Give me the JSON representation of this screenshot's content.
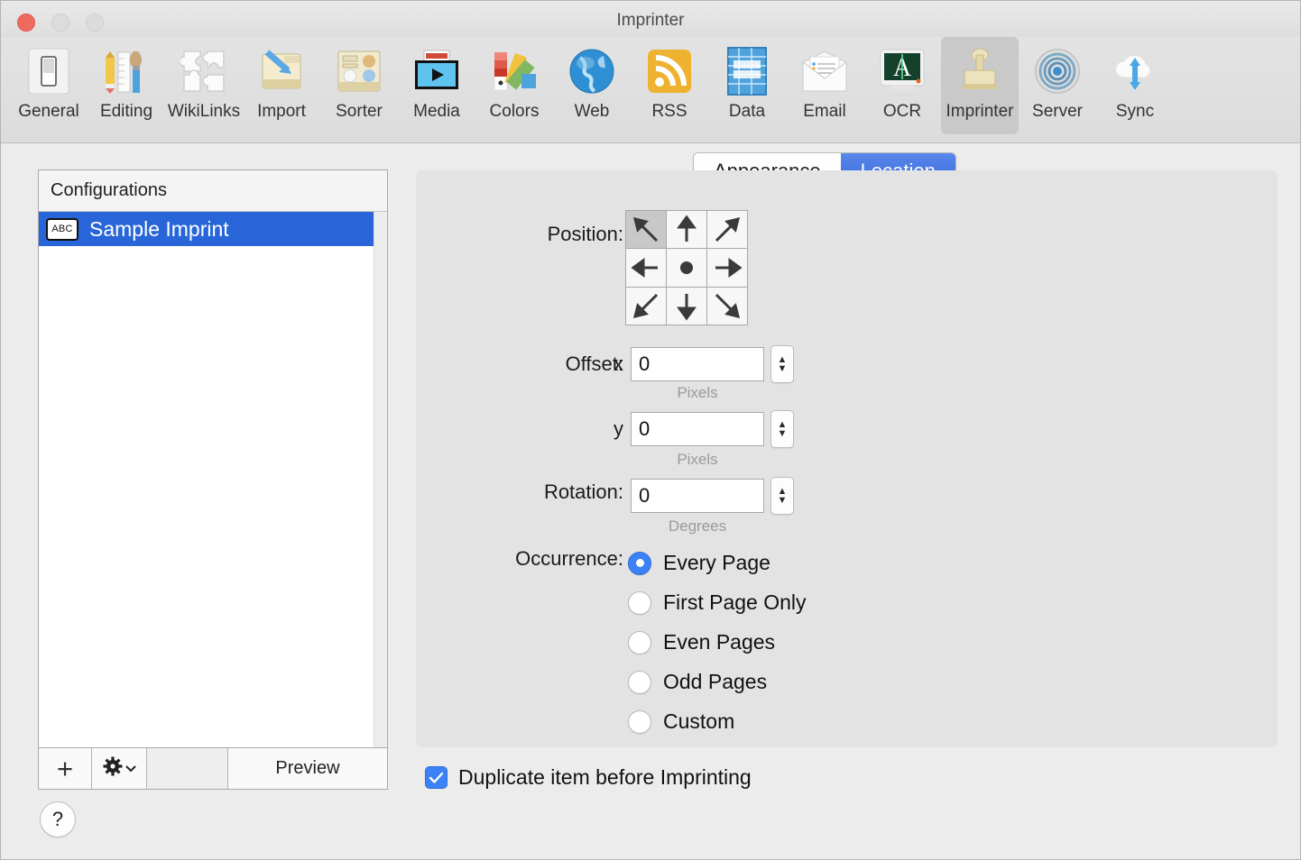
{
  "window": {
    "title": "Imprinter",
    "traffic_lights": [
      "close",
      "minimize",
      "zoom"
    ]
  },
  "toolbar": {
    "items": [
      {
        "label": "General",
        "icon": "switch-icon"
      },
      {
        "label": "Editing",
        "icon": "pencil-ruler-brush-icon"
      },
      {
        "label": "WikiLinks",
        "icon": "puzzle-icon"
      },
      {
        "label": "Import",
        "icon": "import-arrow-icon"
      },
      {
        "label": "Sorter",
        "icon": "sorter-tray-icon"
      },
      {
        "label": "Media",
        "icon": "media-play-icon"
      },
      {
        "label": "Colors",
        "icon": "color-swatches-icon"
      },
      {
        "label": "Web",
        "icon": "globe-icon"
      },
      {
        "label": "RSS",
        "icon": "rss-icon"
      },
      {
        "label": "Data",
        "icon": "data-table-icon"
      },
      {
        "label": "Email",
        "icon": "envelope-icon"
      },
      {
        "label": "OCR",
        "icon": "ocr-screen-icon"
      },
      {
        "label": "Imprinter",
        "icon": "stamp-icon",
        "selected": true
      },
      {
        "label": "Server",
        "icon": "server-rings-icon"
      },
      {
        "label": "Sync",
        "icon": "cloud-sync-icon"
      }
    ]
  },
  "sidebar": {
    "header": "Configurations",
    "rows": [
      {
        "badge": "ABC",
        "label": "Sample Imprint",
        "selected": true
      }
    ],
    "footer": {
      "add_label": "+",
      "gear_icon": "gear-icon",
      "chevron_icon": "chevron-down-icon",
      "preview_label": "Preview"
    }
  },
  "help": {
    "label": "?"
  },
  "tabs": {
    "items": [
      {
        "label": "Appearance",
        "active": false
      },
      {
        "label": "Location",
        "active": true
      }
    ]
  },
  "form": {
    "position": {
      "label": "Position:",
      "cells": [
        {
          "name": "top-left",
          "arrow": "↖",
          "selected": true
        },
        {
          "name": "top-center",
          "arrow": "↑",
          "selected": false
        },
        {
          "name": "top-right",
          "arrow": "↗",
          "selected": false
        },
        {
          "name": "middle-left",
          "arrow": "←",
          "selected": false
        },
        {
          "name": "center",
          "arrow": "●",
          "selected": false
        },
        {
          "name": "middle-right",
          "arrow": "→",
          "selected": false
        },
        {
          "name": "bottom-left",
          "arrow": "↙",
          "selected": false
        },
        {
          "name": "bottom-center",
          "arrow": "↓",
          "selected": false
        },
        {
          "name": "bottom-right",
          "arrow": "↘",
          "selected": false
        }
      ]
    },
    "offset": {
      "label": "Offset:",
      "x_axis": "x",
      "x_value": "0",
      "x_unit": "Pixels",
      "y_axis": "y",
      "y_value": "0",
      "y_unit": "Pixels"
    },
    "rotation": {
      "label": "Rotation:",
      "value": "0",
      "unit": "Degrees"
    },
    "occurrence": {
      "label": "Occurrence:",
      "options": [
        {
          "label": "Every Page",
          "checked": true
        },
        {
          "label": "First Page Only",
          "checked": false
        },
        {
          "label": "Even Pages",
          "checked": false
        },
        {
          "label": "Odd Pages",
          "checked": false
        },
        {
          "label": "Custom",
          "checked": false
        }
      ]
    },
    "duplicate": {
      "label": "Duplicate item before Imprinting",
      "checked": true
    }
  },
  "colors": {
    "accent_blue": "#3b82f6",
    "selection_blue": "#2765d9",
    "tab_active": "#3468d8",
    "window_bg": "#ececec",
    "panel_bg": "#e3e3e3"
  }
}
